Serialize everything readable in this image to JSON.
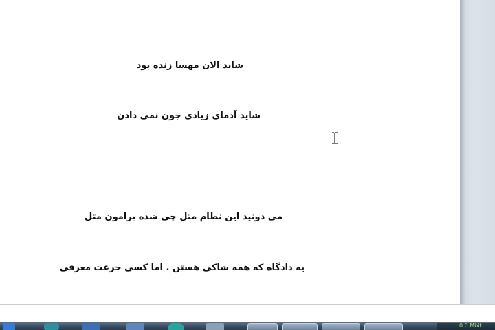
{
  "document": {
    "lines": [
      "شاید الان مهسا زنده بود",
      "شاید آدمای زیادی جون نمی دادن",
      "می دونید این نظام مثل چی شده برامون مثل",
      "یه دادگاه که همه شاکی هستن . اما کسی جرعت معرفی"
    ]
  },
  "taskbar": {
    "tray_text": "0.0 Mbit"
  },
  "colors": {
    "text": "#111111",
    "page": "#ffffff",
    "gutter": "#d6dde5",
    "taskbar": "#3b4d62"
  },
  "icons": [
    "text-caret",
    "i-beam-cursor",
    "taskbar-app-icons"
  ]
}
